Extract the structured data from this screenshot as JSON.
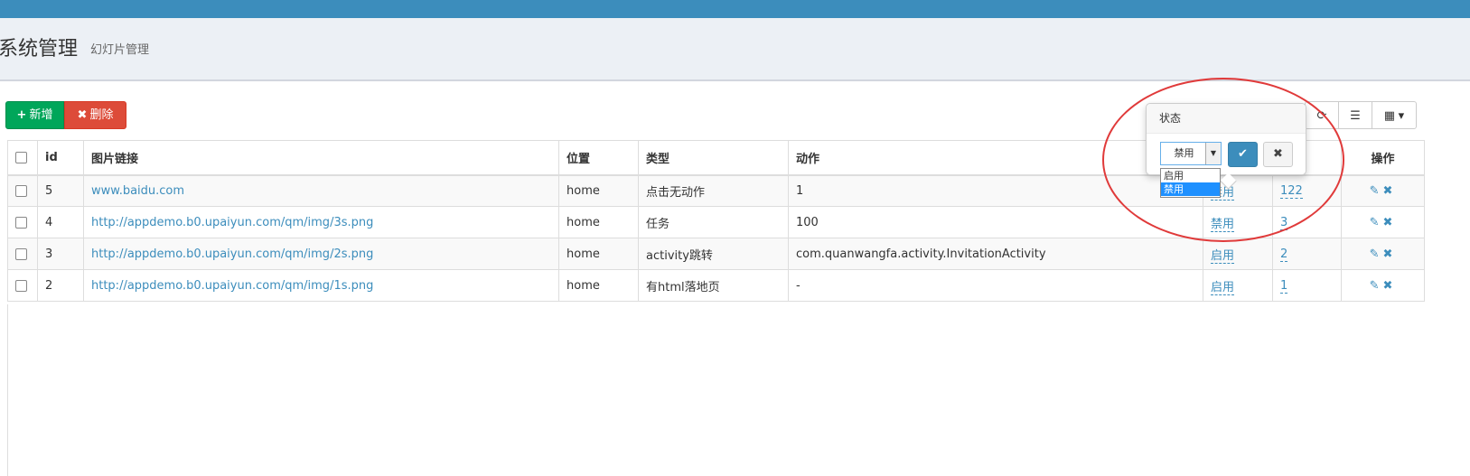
{
  "header": {
    "title": "系统管理",
    "subtitle": "幻灯片管理"
  },
  "toolbar": {
    "add_icon": "+",
    "add_label": "新增",
    "delete_icon": "✖",
    "delete_label": "删除",
    "refresh_icon": "⟳",
    "toggle_icon": "☰",
    "columns_icon": "▦ ▾"
  },
  "table": {
    "columns": [
      "id",
      "图片链接",
      "位置",
      "类型",
      "动作",
      "",
      "",
      "操作"
    ],
    "rows": [
      {
        "id": "5",
        "link": "www.baidu.com",
        "position": "home",
        "type": "点击无动作",
        "action": "1",
        "status": "禁用",
        "order": "122"
      },
      {
        "id": "4",
        "link": "http://appdemo.b0.upaiyun.com/qm/img/3s.png",
        "position": "home",
        "type": "任务",
        "action": "100",
        "status": "禁用",
        "order": "3"
      },
      {
        "id": "3",
        "link": "http://appdemo.b0.upaiyun.com/qm/img/2s.png",
        "position": "home",
        "type": "activity跳转",
        "action": "com.quanwangfa.activity.InvitationActivity",
        "status": "启用",
        "order": "2"
      },
      {
        "id": "2",
        "link": "http://appdemo.b0.upaiyun.com/qm/img/1s.png",
        "position": "home",
        "type": "有html落地页",
        "action": "-",
        "status": "启用",
        "order": "1"
      }
    ],
    "edit_icon": "✎",
    "remove_icon": "✖"
  },
  "popover": {
    "title": "状态",
    "selected": "禁用",
    "options": [
      "启用",
      "禁用"
    ],
    "ok_icon": "✔",
    "cancel_icon": "✖"
  },
  "colors": {
    "topbar": "#3c8dbc",
    "add": "#00a65a",
    "delete": "#dd4b39",
    "link": "#3c8dbc",
    "annotation": "#e03a3a"
  }
}
